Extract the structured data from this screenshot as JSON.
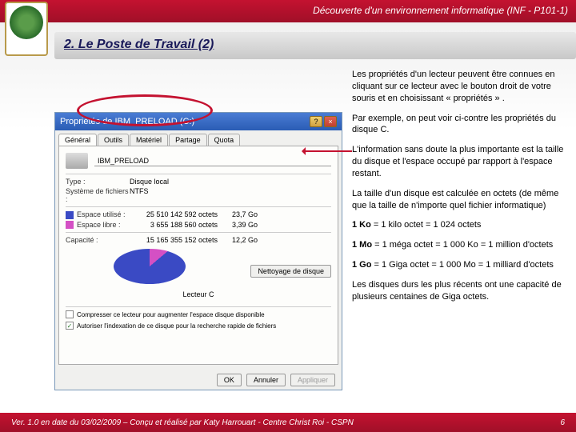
{
  "header": {
    "course": "Découverte d'un environnement informatique (INF - P101-1)"
  },
  "title": "2. Le Poste de Travail (2)",
  "dialog": {
    "caption": "Propriétés de IBM_PRELOAD (C:)",
    "tabs": [
      "Général",
      "Outils",
      "Matériel",
      "Partage",
      "Quota"
    ],
    "drive_name": "IBM_PRELOAD",
    "type_label": "Type :",
    "type_value": "Disque local",
    "fs_label": "Système de fichiers :",
    "fs_value": "NTFS",
    "used_label": "Espace utilisé :",
    "used_bytes": "25 510 142 592 octets",
    "used_gb": "23,7 Go",
    "free_label": "Espace libre :",
    "free_bytes": "3 655 188 560 octets",
    "free_gb": "3,39 Go",
    "cap_label": "Capacité :",
    "cap_bytes": "15 165 355 152 octets",
    "cap_gb": "12,2 Go",
    "pie_label": "Lecteur C",
    "clean_btn": "Nettoyage de disque",
    "chk1": "Compresser ce lecteur pour augmenter l'espace disque disponible",
    "chk2": "Autoriser l'indexation de ce disque pour la recherche rapide de fichiers",
    "ok": "OK",
    "cancel": "Annuler",
    "apply": "Appliquer"
  },
  "paragraphs": {
    "p1": "Les propriétés d'un lecteur peuvent être connues en cliquant sur ce lecteur avec le bouton droit de votre souris et en choisissant « propriétés » .",
    "p2": "Par exemple, on peut voir ci-contre les propriétés du disque C.",
    "p3": "L'information sans doute la plus importante est la taille du disque et l'espace occupé par rapport à l'espace restant.",
    "p4": "La taille d'un disque est calculée en octets (de même que la taille de n'importe quel fichier informatique)",
    "p5a": "1 Ko",
    "p5b": " = 1 kilo octet = 1 024 octets",
    "p6a": "1 Mo",
    "p6b": " = 1 méga octet = 1 000 Ko = 1 million d'octets",
    "p7a": "1 Go",
    "p7b": " = 1 Giga octet = 1 000 Mo = 1 milliard d'octets",
    "p8": "Les disques durs les plus récents ont une capacité de plusieurs centaines de Giga octets."
  },
  "footer": {
    "text": "Ver. 1.0 en date du 03/02/2009 – Conçu et réalisé par Katy Harrouart - Centre Christ Roi - CSPN",
    "page": "6"
  }
}
